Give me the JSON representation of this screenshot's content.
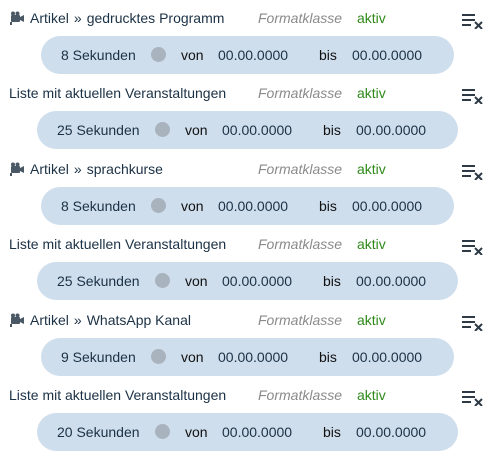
{
  "colors": {
    "pill_background": "#cfdeed",
    "status_active": "#2f8a1a",
    "format_text": "#8a8a8a",
    "dot": "#a9b3be"
  },
  "entries": [
    {
      "icon": "film-camera-icon",
      "prefix": "Artikel",
      "separator": "»",
      "title": "gedrucktes Programm",
      "format_label": "Formatklasse",
      "status": "aktiv",
      "duration": "8 Sekunden",
      "from_label": "von",
      "from_value": "00.00.0000",
      "to_label": "bis",
      "to_value": "00.00.0000"
    },
    {
      "title": "Liste mit aktuellen Veranstaltungen",
      "format_label": "Formatklasse",
      "status": "aktiv",
      "duration": "25 Sekunden",
      "from_label": "von",
      "from_value": "00.00.0000",
      "to_label": "bis",
      "to_value": "00.00.0000"
    },
    {
      "icon": "film-camera-icon",
      "prefix": "Artikel",
      "separator": "»",
      "title": "sprachkurse",
      "format_label": "Formatklasse",
      "status": "aktiv",
      "duration": "8 Sekunden",
      "from_label": "von",
      "from_value": "00.00.0000",
      "to_label": "bis",
      "to_value": "00.00.0000"
    },
    {
      "title": "Liste mit aktuellen Veranstaltungen",
      "format_label": "Formatklasse",
      "status": "aktiv",
      "duration": "25 Sekunden",
      "from_label": "von",
      "from_value": "00.00.0000",
      "to_label": "bis",
      "to_value": "00.00.0000"
    },
    {
      "icon": "film-camera-icon",
      "prefix": "Artikel",
      "separator": "»",
      "title": "WhatsApp Kanal",
      "format_label": "Formatklasse",
      "status": "aktiv",
      "duration": "9 Sekunden",
      "from_label": "von",
      "from_value": "00.00.0000",
      "to_label": "bis",
      "to_value": "00.00.0000"
    },
    {
      "title": "Liste mit aktuellen Veranstaltungen",
      "format_label": "Formatklasse",
      "status": "aktiv",
      "duration": "20 Sekunden",
      "from_label": "von",
      "from_value": "00.00.0000",
      "to_label": "bis",
      "to_value": "00.00.0000"
    }
  ]
}
